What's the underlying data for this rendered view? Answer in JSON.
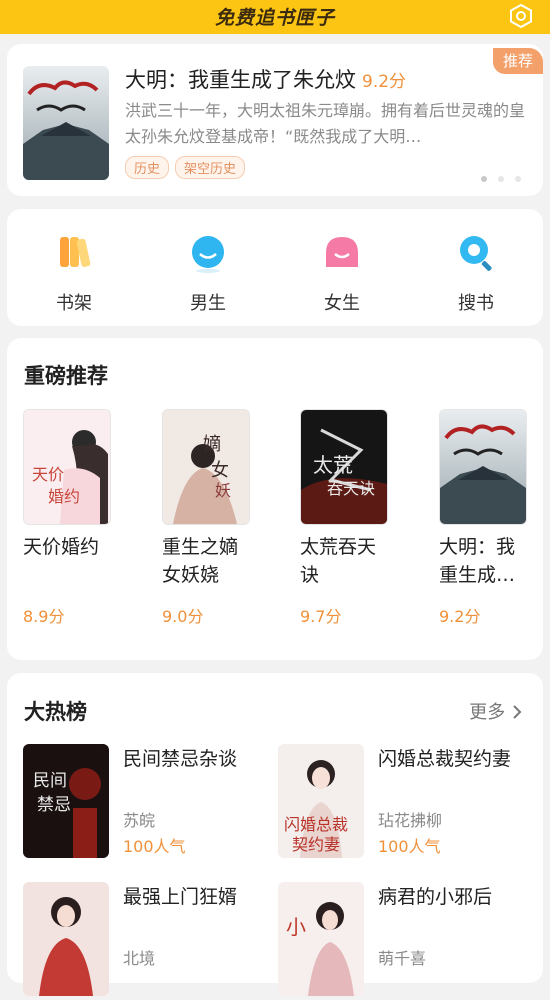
{
  "app": {
    "title": "免费追书匣子",
    "settings_icon": "hexagon-settings-icon"
  },
  "banner": {
    "tag": "推荐",
    "title": "大明：我重生成了朱允炆",
    "score": "9.2分",
    "description": "洪武三十一年，大明太祖朱元璋崩。拥有着后世灵魂的皇太孙朱允炆登基成帝！“既然我成了大明…",
    "tags": [
      "历史",
      "架空历史"
    ],
    "page_count": 3,
    "active_page": 0
  },
  "nav": [
    {
      "label": "书架",
      "icon": "bookshelf-icon",
      "color": "#fca43a"
    },
    {
      "label": "男生",
      "icon": "male-avatar-icon",
      "color": "#2fb6f0"
    },
    {
      "label": "女生",
      "icon": "female-avatar-icon",
      "color": "#f57aa5"
    },
    {
      "label": "搜书",
      "icon": "search-icon",
      "color": "#33b9f2"
    }
  ],
  "featured": {
    "title": "重磅推荐",
    "books": [
      {
        "title": "天价婚约",
        "score": "8.9分"
      },
      {
        "title": "重生之嫡女妖娆",
        "score": "9.0分"
      },
      {
        "title": "太荒吞天诀",
        "score": "9.7分"
      },
      {
        "title": "大明：我重生成…",
        "score": "9.2分"
      }
    ]
  },
  "ranking": {
    "title": "大热榜",
    "more_label": "更多",
    "items": [
      {
        "title": "民间禁忌杂谈",
        "author": "苏皖",
        "popularity": "100人气"
      },
      {
        "title": "闪婚总裁契约妻",
        "author": "玷花拂柳",
        "popularity": "100人气"
      },
      {
        "title": "最强上门狂婿",
        "author": "北境",
        "popularity": ""
      },
      {
        "title": "病君的小邪后",
        "author": "萌千喜",
        "popularity": ""
      }
    ]
  },
  "colors": {
    "accent": "#fcc514",
    "score": "#f0913a",
    "tag_bg": "#f4a06a"
  }
}
